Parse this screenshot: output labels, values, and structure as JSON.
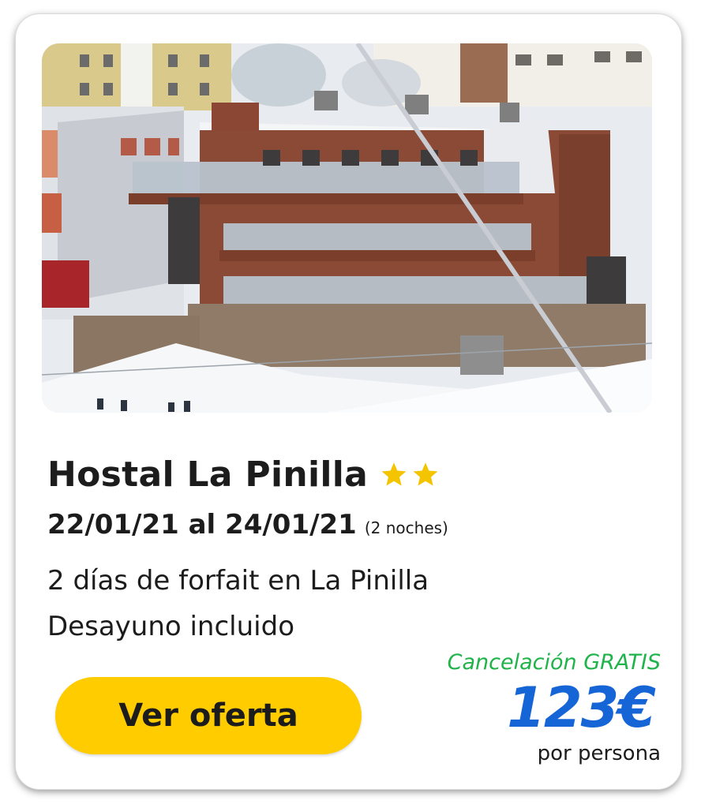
{
  "hotel": {
    "name": "Hostal La Pinilla",
    "stars": 2,
    "star_color": "#f5c400",
    "image_description_icon": "hotel-photo"
  },
  "stay": {
    "dates": "22/01/21 al 24/01/21",
    "nights": "(2 noches)"
  },
  "features": [
    "2 días de forfait en La Pinilla",
    "Desayuno incluido"
  ],
  "offer": {
    "button_label": "Ver oferta",
    "cancellation": "Cancelación GRATIS",
    "price": "123€",
    "price_unit": "por persona"
  },
  "colors": {
    "button": "#ffcc00",
    "price": "#1565d6",
    "cancellation": "#1fb34a",
    "text": "#1c1c1c"
  }
}
